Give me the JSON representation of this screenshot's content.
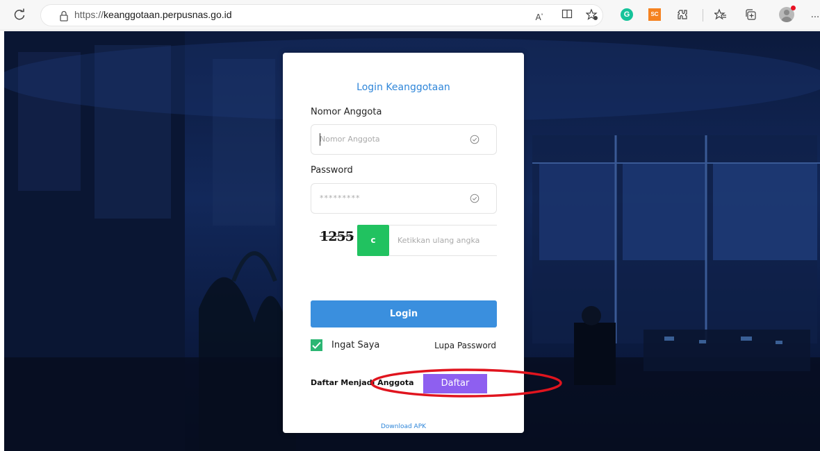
{
  "browser": {
    "url_prefix": "https://",
    "url_host": "keanggotaan.perpusnas.go.id",
    "icons": [
      "refresh-icon",
      "lock-icon",
      "read-aloud-icon",
      "split-screen-icon",
      "favorite-add-icon",
      "grammarly-extension-icon",
      "sc-extension-icon",
      "extensions-icon",
      "favorites-icon",
      "collections-icon",
      "profile-avatar",
      "more-icon"
    ],
    "ext_g_label": "G",
    "ext_sc_label": "SC",
    "more_label": "..."
  },
  "login": {
    "title": "Login Keanggotaan",
    "member_label": "Nomor Anggota",
    "member_placeholder": "Nomor Anggota",
    "password_label": "Password",
    "password_placeholder": "*********",
    "captcha_code": "1255",
    "refresh_label": "c",
    "captcha_placeholder": "Ketikkan ulang angka",
    "login_button": "Login",
    "remember_label": "Ingat Saya",
    "forgot_label": "Lupa Password",
    "register_text": "Daftar Menjadi Anggota",
    "register_button": "Daftar",
    "download_label": "Download APK"
  },
  "colors": {
    "accent_blue": "#3a8fde",
    "refresh_green": "#21c260",
    "daftar_purple": "#8e5ff0",
    "annotation_red": "#e0141e"
  }
}
